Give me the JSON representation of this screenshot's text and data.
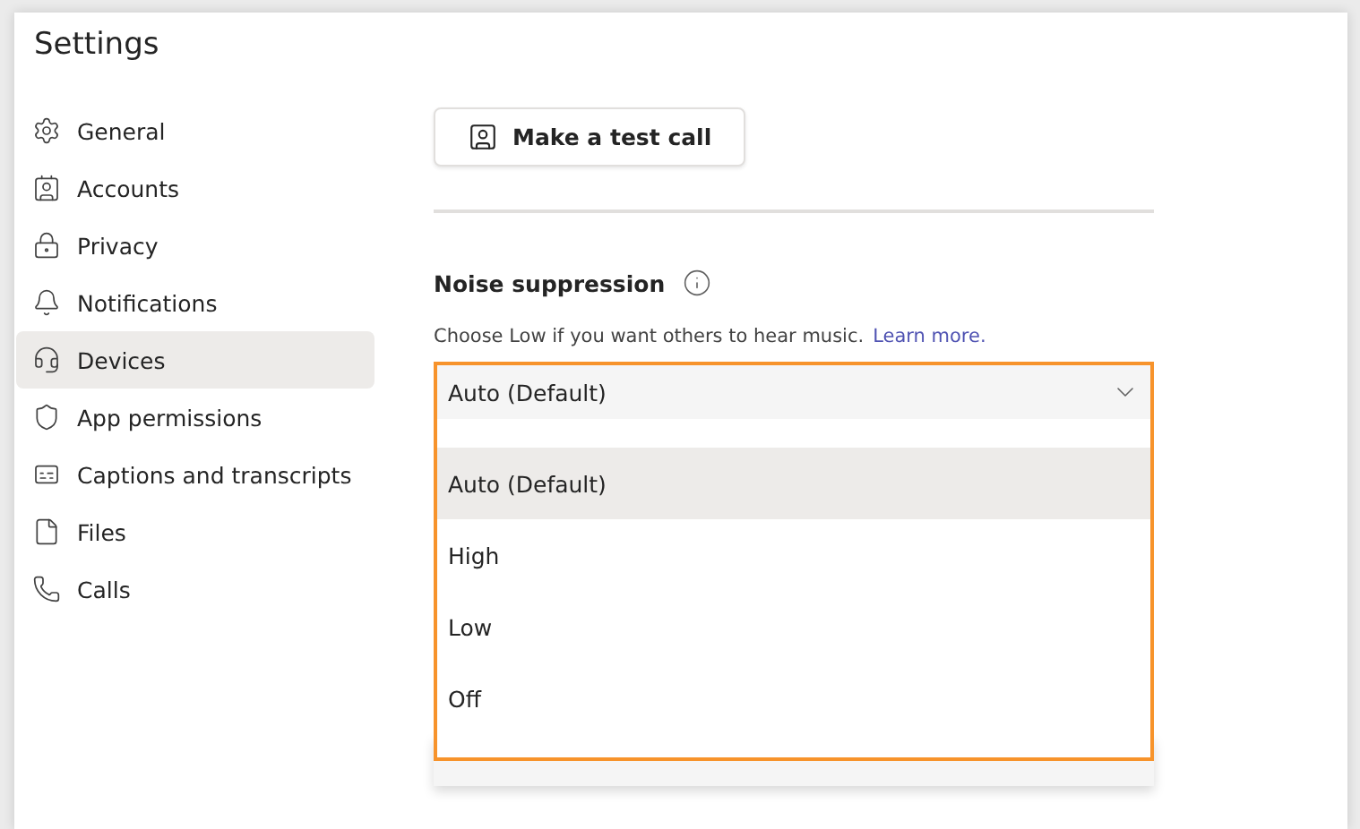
{
  "title": "Settings",
  "nav": [
    {
      "label": "General",
      "selected": false
    },
    {
      "label": "Accounts",
      "selected": false
    },
    {
      "label": "Privacy",
      "selected": false
    },
    {
      "label": "Notifications",
      "selected": false
    },
    {
      "label": "Devices",
      "selected": true
    },
    {
      "label": "App permissions",
      "selected": false
    },
    {
      "label": "Captions and transcripts",
      "selected": false
    },
    {
      "label": "Files",
      "selected": false
    },
    {
      "label": "Calls",
      "selected": false
    }
  ],
  "test_call_button": "Make a test call",
  "noise": {
    "heading": "Noise suppression",
    "help": "Choose Low if you want others to hear music.",
    "link": "Learn more.",
    "value": "Auto (Default)",
    "options": [
      {
        "label": "Auto (Default)",
        "selected": true
      },
      {
        "label": "High",
        "selected": false
      },
      {
        "label": "Low",
        "selected": false
      },
      {
        "label": "Off",
        "selected": false
      }
    ]
  }
}
